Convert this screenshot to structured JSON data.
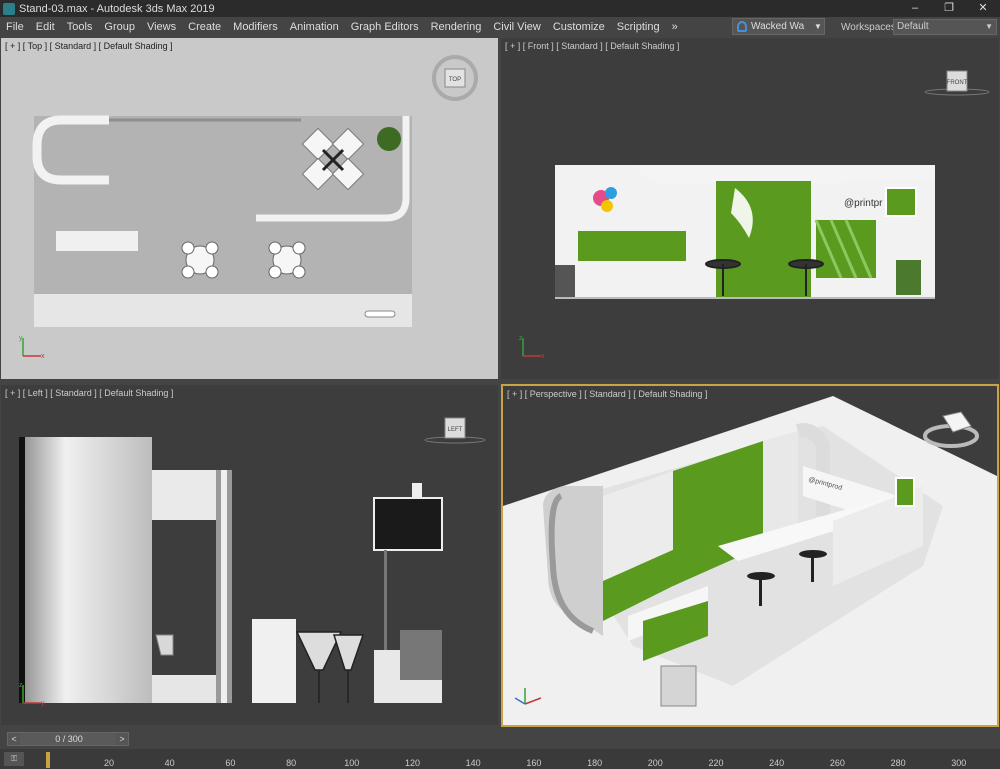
{
  "window": {
    "title": "Stand-03.max - Autodesk 3ds Max 2019",
    "minimize": "–",
    "maximize": "❐",
    "close": "✕"
  },
  "menu": [
    "File",
    "Edit",
    "Tools",
    "Group",
    "Views",
    "Create",
    "Modifiers",
    "Animation",
    "Graph Editors",
    "Rendering",
    "Civil View",
    "Customize",
    "Scripting"
  ],
  "menu_overflow": "»",
  "account": {
    "name": "Wacked Wa",
    "icon": "user-icon"
  },
  "workspaces": {
    "label": "Workspaces:",
    "value": "Default"
  },
  "viewports": {
    "top": {
      "label": "[ + ] [ Top ] [ Standard ] [ Default Shading ]",
      "cube": "TOP",
      "axes": [
        "y",
        "x"
      ]
    },
    "front": {
      "label": "[ + ] [ Front ] [ Standard ] [ Default Shading ]",
      "cube": "FRONT",
      "axes": [
        "z",
        "x"
      ],
      "sign_text": "@printpr"
    },
    "left": {
      "label": "[ + ] [ Left ] [ Standard ] [ Default Shading ]",
      "cube": "LEFT",
      "axes": [
        "z",
        "y"
      ]
    },
    "perspective": {
      "label": "[ + ] [ Perspective ] [ Standard ] [ Default Shading ]",
      "active": true,
      "sign_text": "@printprod"
    }
  },
  "colors": {
    "accent": "#c8a349",
    "green": "#5a9a1f",
    "viewport_bg": "#3d3d3d",
    "top_bg": "#c9c9c9"
  },
  "timeline": {
    "frame": "0 / 300",
    "prev": "<",
    "next": ">",
    "key_icon": "key-icon",
    "key_label": "⚿",
    "ticks": [
      "20",
      "40",
      "60",
      "80",
      "100",
      "120",
      "140",
      "160",
      "180",
      "200",
      "220",
      "240",
      "260",
      "280",
      "300"
    ]
  }
}
